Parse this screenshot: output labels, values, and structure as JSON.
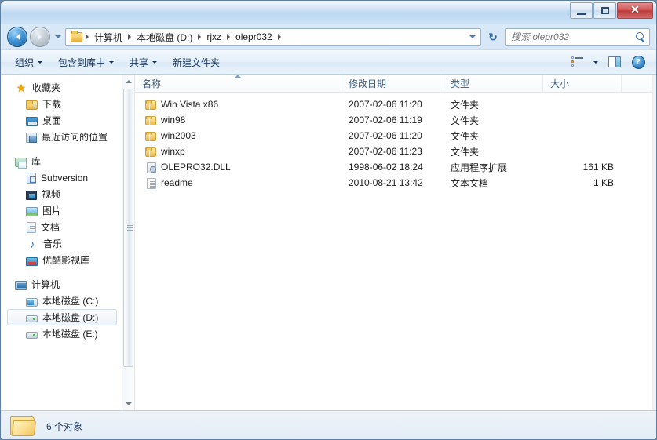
{
  "window": {
    "controls": {
      "minimize_label": "最小化",
      "maximize_label": "最大化",
      "close_label": "✕"
    }
  },
  "address_bar": {
    "back_label": "后退",
    "forward_label": "前进",
    "history_label": "最近浏览的位置",
    "breadcrumbs": [
      "计算机",
      "本地磁盘 (D:)",
      "rjxz",
      "olepr032"
    ],
    "refresh_label": "↻"
  },
  "search": {
    "placeholder": "搜索 olepr032",
    "value": ""
  },
  "toolbar": {
    "buttons": [
      {
        "label": "组织",
        "has_caret": true
      },
      {
        "label": "包含到库中",
        "has_caret": true
      },
      {
        "label": "共享",
        "has_caret": true
      },
      {
        "label": "新建文件夹",
        "has_caret": false
      }
    ],
    "view_label": "更改您的视图",
    "preview_label": "显示预览窗格",
    "help_label": "?"
  },
  "sidebar": {
    "groups": [
      {
        "root": {
          "label": "收藏夹",
          "icon": "star-icon"
        },
        "items": [
          {
            "label": "下载",
            "icon": "download-folder-icon"
          },
          {
            "label": "桌面",
            "icon": "desktop-icon"
          },
          {
            "label": "最近访问的位置",
            "icon": "recent-places-icon"
          }
        ]
      },
      {
        "root": {
          "label": "库",
          "icon": "library-icon"
        },
        "items": [
          {
            "label": "Subversion",
            "icon": "subversion-icon"
          },
          {
            "label": "视频",
            "icon": "video-icon"
          },
          {
            "label": "图片",
            "icon": "picture-icon"
          },
          {
            "label": "文档",
            "icon": "document-icon"
          },
          {
            "label": "音乐",
            "icon": "music-icon"
          },
          {
            "label": "优酷影视库",
            "icon": "youku-icon"
          }
        ]
      },
      {
        "root": {
          "label": "计算机",
          "icon": "computer-icon"
        },
        "items": [
          {
            "label": "本地磁盘 (C:)",
            "icon": "system-drive-icon",
            "selected": false
          },
          {
            "label": "本地磁盘 (D:)",
            "icon": "drive-icon",
            "selected": true
          },
          {
            "label": "本地磁盘 (E:)",
            "icon": "drive-icon",
            "selected": false
          }
        ]
      }
    ]
  },
  "file_list": {
    "columns": [
      {
        "key": "name",
        "label": "名称",
        "sorted": "asc"
      },
      {
        "key": "date",
        "label": "修改日期"
      },
      {
        "key": "type",
        "label": "类型"
      },
      {
        "key": "size",
        "label": "大小"
      }
    ],
    "rows": [
      {
        "name": "Win Vista x86",
        "date": "2007-02-06 11:20",
        "type": "文件夹",
        "size": "",
        "icon": "folder-icon"
      },
      {
        "name": "win98",
        "date": "2007-02-06 11:19",
        "type": "文件夹",
        "size": "",
        "icon": "folder-icon"
      },
      {
        "name": "win2003",
        "date": "2007-02-06 11:20",
        "type": "文件夹",
        "size": "",
        "icon": "folder-icon"
      },
      {
        "name": "winxp",
        "date": "2007-02-06 11:23",
        "type": "文件夹",
        "size": "",
        "icon": "folder-icon"
      },
      {
        "name": "OLEPRO32.DLL",
        "date": "1998-06-02 18:24",
        "type": "应用程序扩展",
        "size": "161 KB",
        "icon": "dll-icon"
      },
      {
        "name": "readme",
        "date": "2010-08-21 13:42",
        "type": "文本文档",
        "size": "1 KB",
        "icon": "text-file-icon"
      }
    ]
  },
  "status_bar": {
    "item_count_text": "6 个对象"
  },
  "colors": {
    "accent": "#2c6fb0",
    "titlebar": "#c3dbf2",
    "close_button": "#bc3b3b",
    "folder": "#f9d273"
  }
}
